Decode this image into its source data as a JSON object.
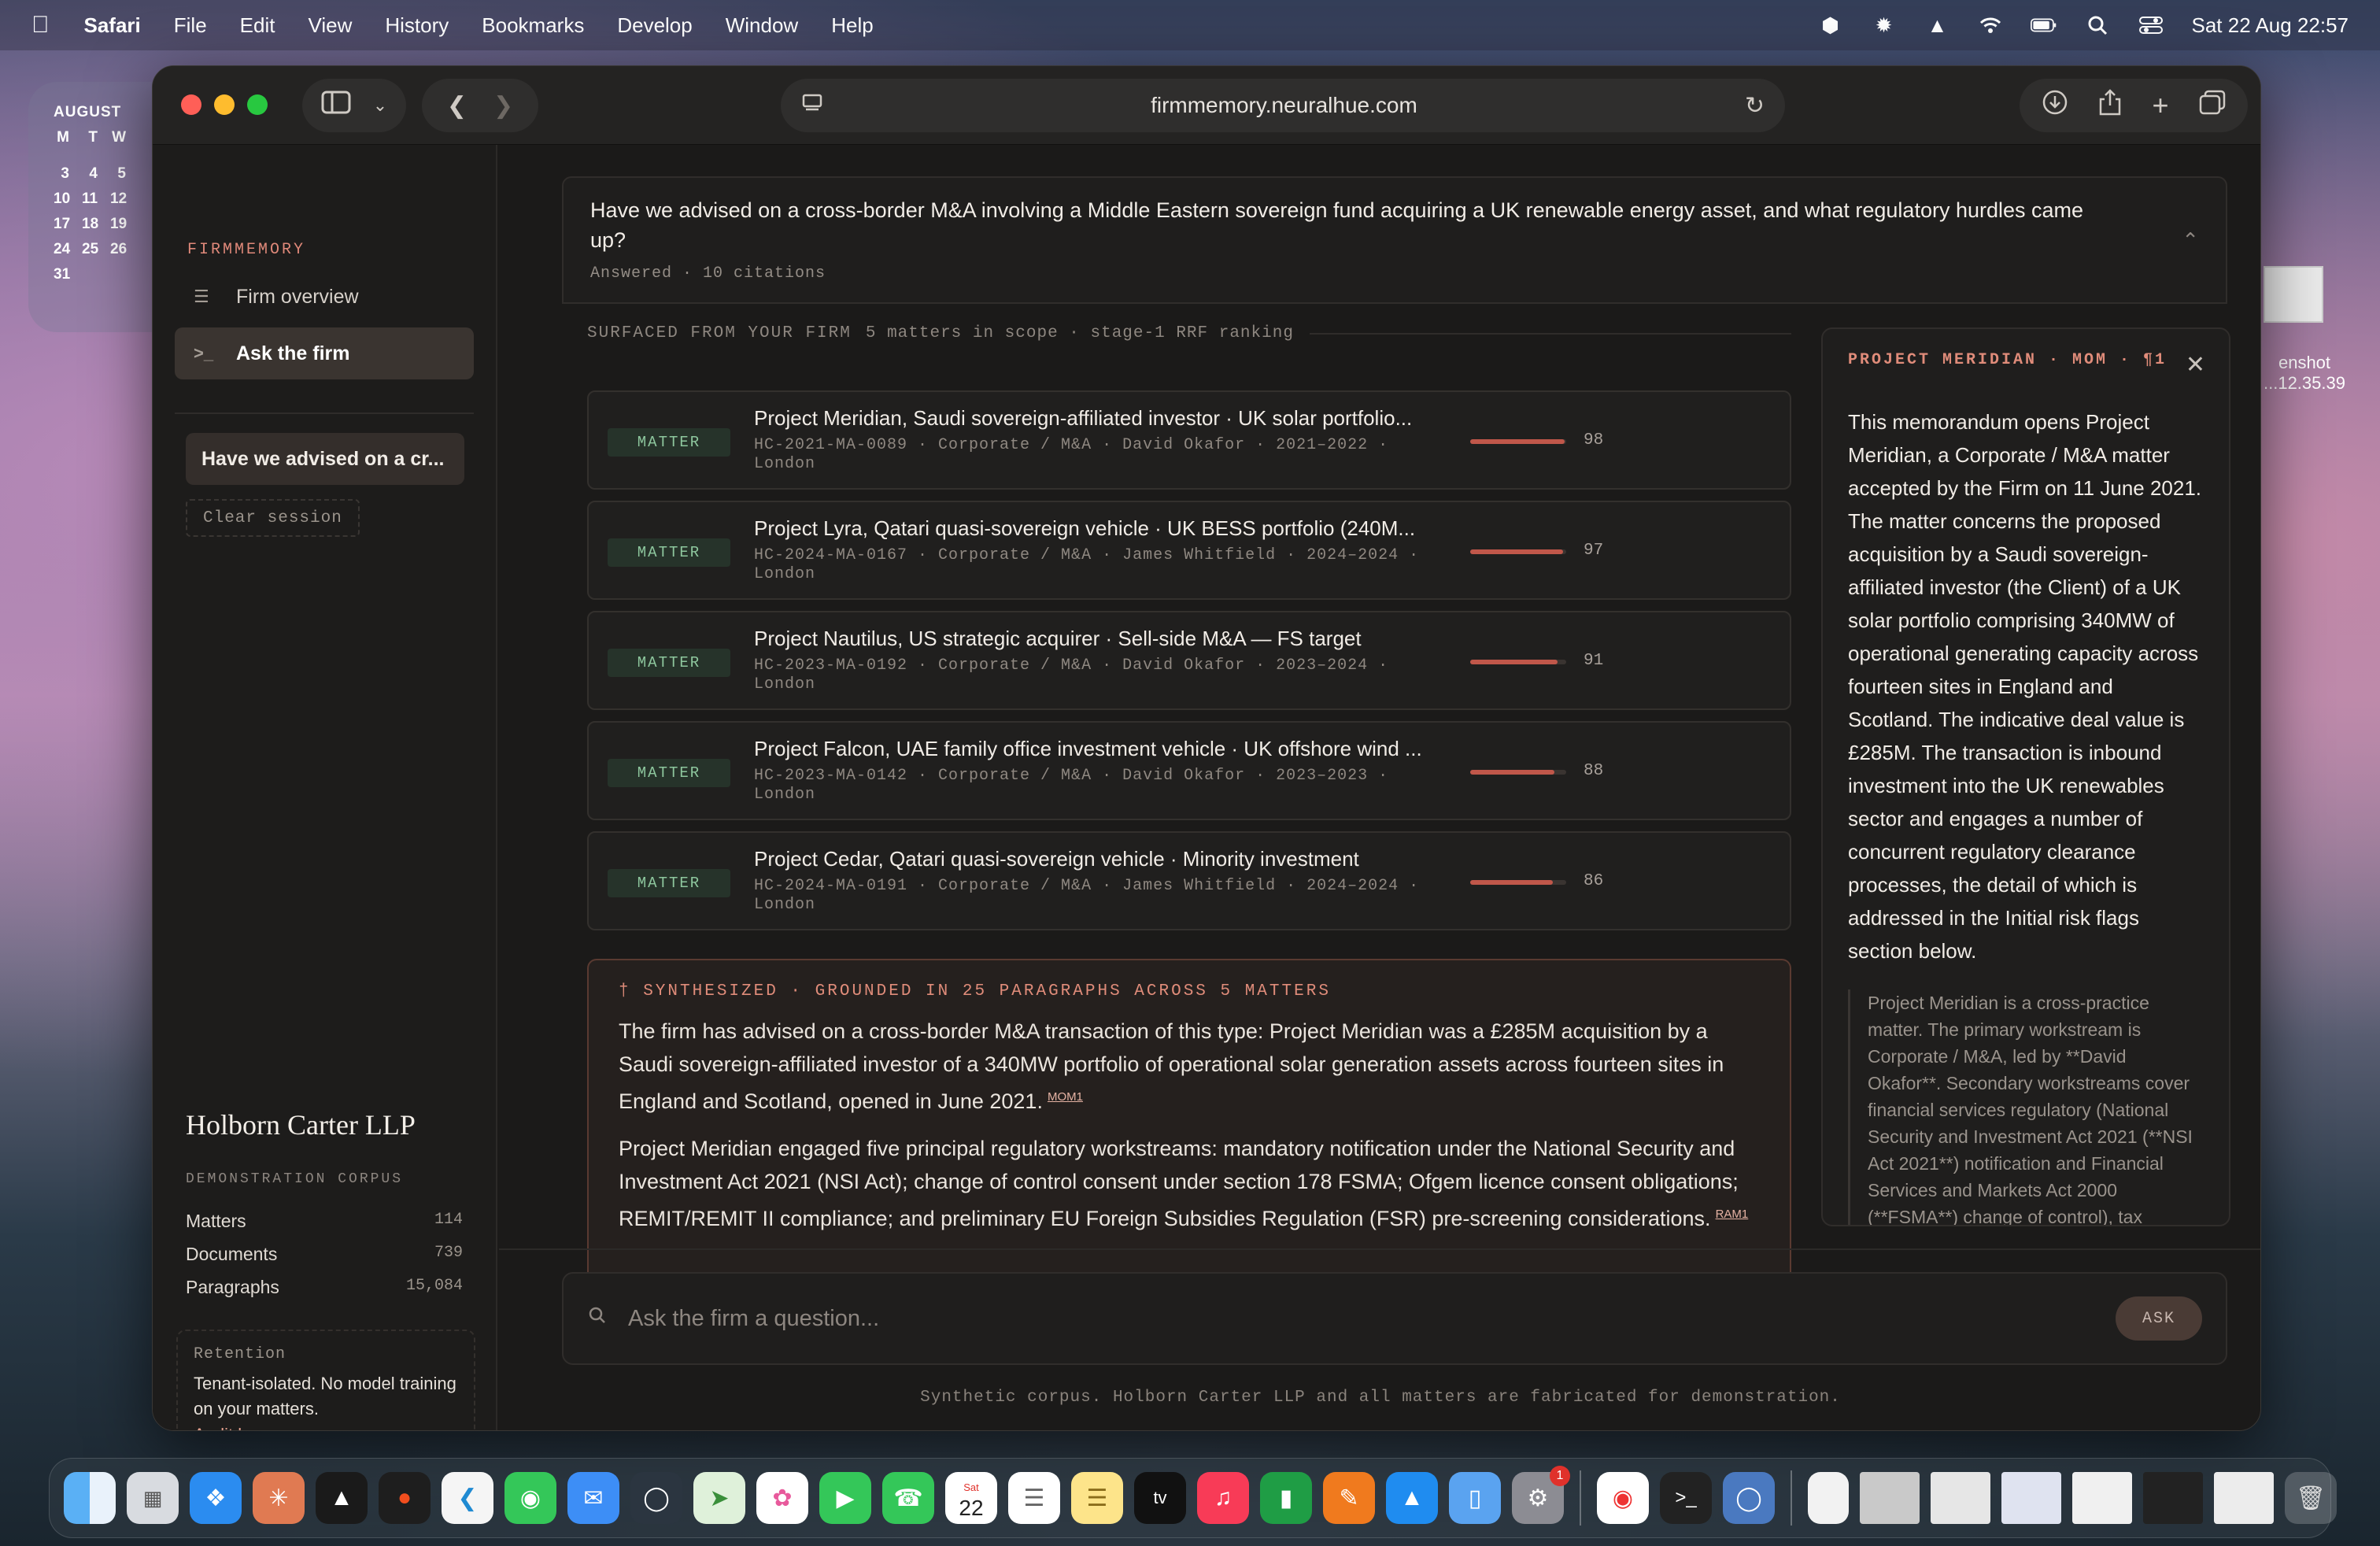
{
  "menubar": {
    "app": "Safari",
    "items": [
      "File",
      "Edit",
      "View",
      "History",
      "Bookmarks",
      "Develop",
      "Window",
      "Help"
    ],
    "clock": "Sat 22 Aug  22:57"
  },
  "calendar_widget": {
    "month": "AUGUST",
    "weekdays": [
      "M",
      "T",
      "W"
    ],
    "weeks": [
      [
        "3",
        "4",
        "5"
      ],
      [
        "10",
        "11",
        "12"
      ],
      [
        "17",
        "18",
        "19"
      ],
      [
        "24",
        "25",
        "26"
      ],
      [
        "31",
        "",
        ""
      ]
    ]
  },
  "desktop_file": {
    "label_line1": "enshot",
    "label_line2": "...12.35.39"
  },
  "browser": {
    "url": "firmmemory.neuralhue.com"
  },
  "sidebar": {
    "brand": "FIRMMEMORY",
    "nav": [
      {
        "label": "Firm overview",
        "icon": "list-icon"
      },
      {
        "label": "Ask the firm",
        "icon": "terminal-icon"
      }
    ],
    "session_label": "Have we advised on a cr...",
    "clear_label": "Clear session",
    "firm_name": "Holborn Carter LLP",
    "corpus_label": "DEMONSTRATION CORPUS",
    "stats": [
      {
        "label": "Matters",
        "value": "114"
      },
      {
        "label": "Documents",
        "value": "739"
      },
      {
        "label": "Paragraphs",
        "value": "15,084"
      }
    ],
    "retention": {
      "label": "Retention",
      "text": "Tenant-isolated. No model training on your matters.",
      "link": "Audit log →"
    }
  },
  "question": {
    "text": "Have we advised on a cross-border M&A involving a Middle Eastern sovereign fund acquiring a UK renewable energy asset, and what regulatory hurdles came up?",
    "meta": "Answered · 10 citations"
  },
  "surfaced": {
    "label": "SURFACED FROM YOUR FIRM",
    "detail": "5 matters in scope · stage-1 RRF ranking"
  },
  "matters": [
    {
      "badge": "MATTER",
      "title": "Project Meridian, Saudi sovereign-affiliated investor · UK solar portfolio...",
      "sub": "HC-2021-MA-0089 · Corporate / M&A · David Okafor · 2021–2022 · London",
      "score": 98
    },
    {
      "badge": "MATTER",
      "title": "Project Lyra, Qatari quasi-sovereign vehicle · UK BESS portfolio (240M...",
      "sub": "HC-2024-MA-0167 · Corporate / M&A · James Whitfield · 2024–2024 · London",
      "score": 97
    },
    {
      "badge": "MATTER",
      "title": "Project Nautilus, US strategic acquirer · Sell-side M&A — FS target",
      "sub": "HC-2023-MA-0192 · Corporate / M&A · David Okafor · 2023–2024 · London",
      "score": 91
    },
    {
      "badge": "MATTER",
      "title": "Project Falcon, UAE family office investment vehicle · UK offshore wind ...",
      "sub": "HC-2023-MA-0142 · Corporate / M&A · David Okafor · 2023–2023 · London",
      "score": 88
    },
    {
      "badge": "MATTER",
      "title": "Project Cedar, Qatari quasi-sovereign vehicle · Minority investment",
      "sub": "HC-2024-MA-0191 · Corporate / M&A · James Whitfield · 2024–2024 · London",
      "score": 86
    }
  ],
  "synthesis": {
    "head": "† SYNTHESIZED · GROUNDED IN 25 PARAGRAPHS ACROSS 5 MATTERS",
    "p1": "The firm has advised on a cross-border M&A transaction of this type: Project Meridian was a £285M acquisition by a Saudi sovereign-affiliated investor of a 340MW portfolio of operational solar generation assets across fourteen sites in England and Scotland, opened in June 2021.",
    "p1_cite": "MOM1",
    "p2": "Project Meridian engaged five principal regulatory workstreams: mandatory notification under the National Security and Investment Act 2021 (NSI Act); change of control consent under section 178 FSMA; Ofgem licence consent obligations; REMIT/REMIT II compliance; and preliminary EU Foreign Subsidies Regulation (FSR) pre-screening considerations.",
    "p2_cite": "RAM1"
  },
  "citation_panel": {
    "head": "PROJECT MERIDIAN · MOM · ¶1",
    "body": "This memorandum opens Project Meridian, a Corporate / M&A matter accepted by the Firm on 11 June 2021. The matter concerns the proposed acquisition by a Saudi sovereign-affiliated investor (the Client) of a UK solar portfolio comprising 340MW of operational generating capacity across fourteen sites in England and Scotland. The indicative deal value is £285M. The transaction is inbound investment into the UK renewables sector and engages a number of concurrent regulatory clearance processes, the detail of which is addressed in the Initial risk flags section below.",
    "quote": "Project Meridian is a cross-practice matter. The primary workstream is Corporate / M&A, led by **David Okafor**. Secondary workstreams cover financial services regulatory (National Security and Investment Act 2021 (**NSI Act 2021**) notification and Financial Services and Markets Act 2000 (**FSMA**) change of control), tax structuring, and real estate title and licence matters. Given the breadth of the regulatory programme, the Firm anticipates that the transaction timetable will be driven principally by the NSI Act 2021 clearance process, with an estimated duration from signing of heads of terms to completion of approximately five to six months."
  },
  "ask": {
    "placeholder": "Ask the firm a question...",
    "button": "ASK"
  },
  "footer": "Synthetic corpus. Holborn Carter LLP and all matters are fabricated for demonstration.",
  "dock": {
    "calendar_month": "Sat",
    "calendar_day": "22",
    "badge_count": "1",
    "app_icons": [
      "finder-icon",
      "launchpad-icon",
      "safari-icon",
      "claude-icon",
      "cursor-icon",
      "figma-icon",
      "vscode-icon",
      "messages-icon",
      "mail-icon",
      "app-icon",
      "maps-icon",
      "photos-icon",
      "facetime-icon",
      "phone-icon",
      "calendar-icon",
      "reminders-icon",
      "notes-icon",
      "appletv-icon",
      "music-icon",
      "numbers-icon",
      "pages-icon",
      "appstore-icon",
      "files-icon",
      "settings-icon",
      "chrome-icon",
      "terminal-icon",
      "disk-icon"
    ]
  }
}
